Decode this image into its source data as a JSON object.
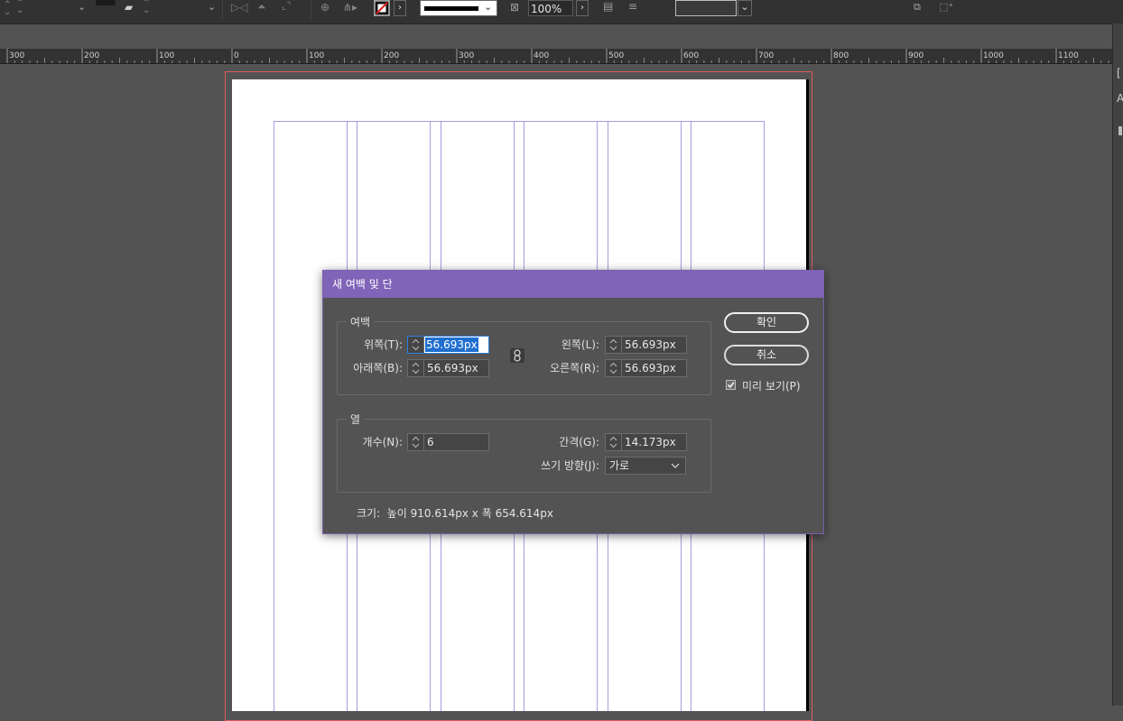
{
  "control_bar": {
    "zoom": "100%",
    "icons": [
      "stepper-icon",
      "stepper-icon",
      "dropdown-icon",
      "slant-icon",
      "dropdown-icon",
      "flip-icon",
      "rotate-icon",
      "align-icon",
      "distribute-icon",
      "stroke-swatch-icon",
      "stroke-style-icon",
      "frame-fit-icon",
      "text-wrap-icon",
      "wrap-options-icon",
      "arrange-icon",
      "transform-icon"
    ]
  },
  "ruler": {
    "labels": [
      "300",
      "200",
      "100",
      "0",
      "100",
      "200",
      "300",
      "400",
      "500",
      "600",
      "700",
      "800",
      "900",
      "1000",
      "1100"
    ]
  },
  "right_panel": {
    "glyphs": [
      "[",
      "A"
    ]
  },
  "dialog": {
    "title": "새 여백 및 단",
    "margins": {
      "group_label": "여백",
      "top_label": "위쪽(T):",
      "top_value": "56.693px",
      "bottom_label": "아래쪽(B):",
      "bottom_value": "56.693px",
      "left_label": "왼쪽(L):",
      "left_value": "56.693px",
      "right_label": "오른쪽(R):",
      "right_value": "56.693px"
    },
    "columns": {
      "group_label": "열",
      "count_label": "개수(N):",
      "count_value": "6",
      "gutter_label": "간격(G):",
      "gutter_value": "14.173px",
      "direction_label": "쓰기 방향(J):",
      "direction_value": "가로"
    },
    "size_text": "크기:  높이 910.614px x 폭 654.614px",
    "ok_label": "확인",
    "cancel_label": "취소",
    "preview_label": "미리 보기(P)",
    "preview_checked": true
  },
  "colors": {
    "title_bar": "#8064b8",
    "guide": "#a89ce0",
    "bleed": "#e05a5a",
    "selection": "#1f6fd0"
  }
}
